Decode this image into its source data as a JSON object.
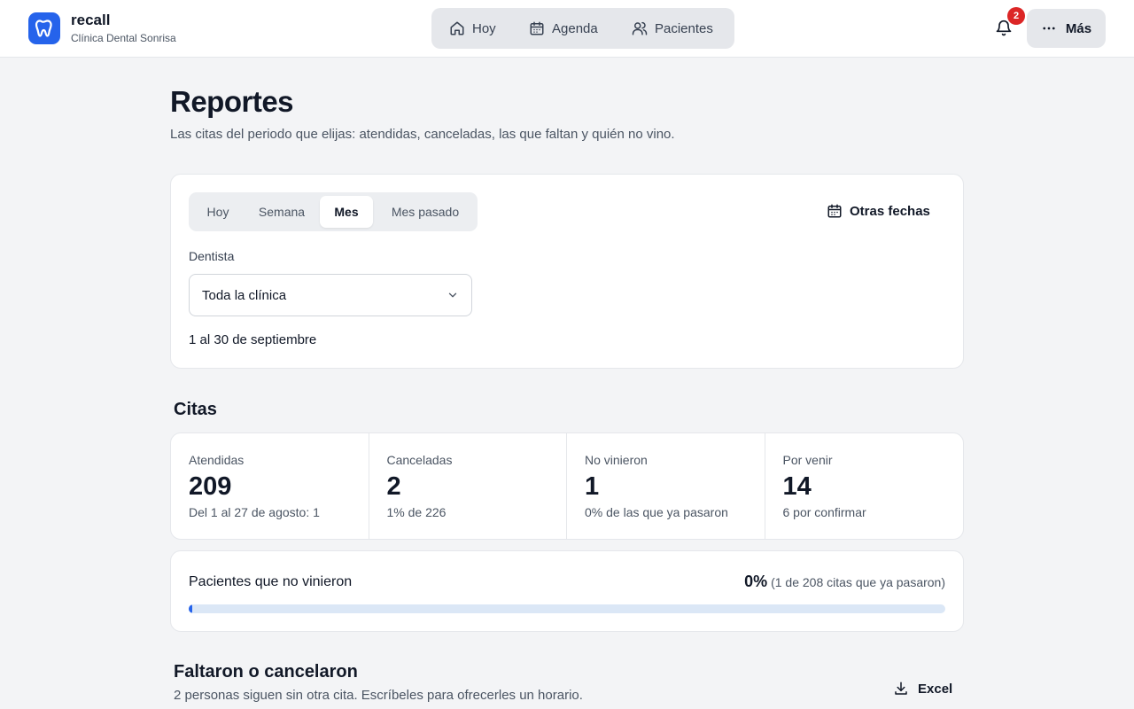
{
  "brand": {
    "name": "recall",
    "clinic": "Clínica Dental Sonrisa",
    "accent": "#2563eb"
  },
  "nav": {
    "items": [
      {
        "label": "Hoy",
        "icon": "home-icon"
      },
      {
        "label": "Agenda",
        "icon": "calendar-icon"
      },
      {
        "label": "Pacientes",
        "icon": "users-icon"
      }
    ],
    "notifications_count": "2",
    "more_label": "Más"
  },
  "header": {
    "title": "Reportes",
    "subtitle": "Las citas del periodo que elijas: atendidas, canceladas, las que faltan y quién no vino."
  },
  "filters": {
    "periods": [
      "Hoy",
      "Semana",
      "Mes",
      "Mes pasado"
    ],
    "active_period": "Mes",
    "other_dates_label": "Otras fechas",
    "dentist_label": "Dentista",
    "dentist_value": "Toda la clínica",
    "range_text": "1 al 30 de septiembre"
  },
  "citas": {
    "title": "Citas",
    "stats": [
      {
        "label": "Atendidas",
        "value": "209",
        "note": "Del 1 al 27 de agosto: 1"
      },
      {
        "label": "Canceladas",
        "value": "2",
        "note": "1% de 226"
      },
      {
        "label": "No vinieron",
        "value": "1",
        "note": "0% de las que ya pasaron"
      },
      {
        "label": "Por venir",
        "value": "14",
        "note": "6 por confirmar"
      }
    ]
  },
  "no_show": {
    "label": "Pacientes que no vinieron",
    "percent": "0%",
    "detail": "(1 de 208 citas que ya pasaron)",
    "fraction": 0.0048,
    "track_color": "#dbe7f6",
    "fill_color": "#2563eb"
  },
  "missed": {
    "title": "Faltaron o cancelaron",
    "subtitle": "2 personas siguen sin otra cita. Escríbeles para ofrecerles un horario.",
    "export_label": "Excel",
    "export_icon": "download-icon"
  }
}
